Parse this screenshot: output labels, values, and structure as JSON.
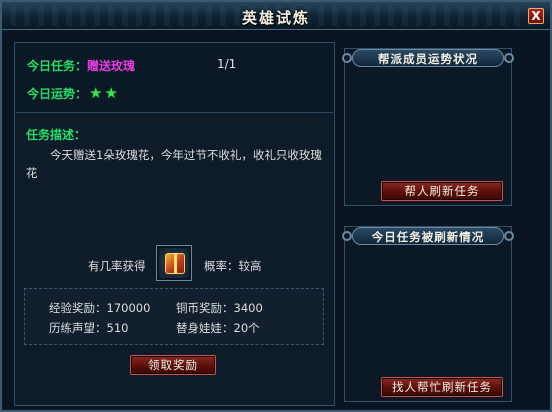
{
  "window": {
    "title": "英雄试炼",
    "close_label": "X"
  },
  "task": {
    "today_task_label": "今日任务：",
    "task_name": "赠送玫瑰",
    "progress": "1/1",
    "fortune_label": "今日运势：",
    "fortune_stars": 2,
    "star_glyph": "★"
  },
  "description": {
    "title": "任务描述：",
    "text": "今天赠送1朵玫瑰花，今年过节不收礼，收礼只收玫瑰花"
  },
  "reward_chance": {
    "label": "有几率获得",
    "item_icon": "gift-box-icon",
    "rate_text": "概率：较高"
  },
  "rewards": {
    "exp": "经验奖励：170000",
    "copper": "铜币奖励：3400",
    "prestige": "历练声望：510",
    "doll": "替身娃娃：20个"
  },
  "buttons": {
    "claim": "领取奖励",
    "help_refresh": "帮人刷新任务",
    "ask_refresh": "找人帮忙刷新任务"
  },
  "right_panels": {
    "guild_fortune_title": "帮派成员运势状况",
    "refresh_status_title": "今日任务被刷新情况"
  },
  "colors": {
    "accent_green": "#23e06a",
    "task_magenta": "#e63ce0",
    "button_red": "#6d1510"
  }
}
